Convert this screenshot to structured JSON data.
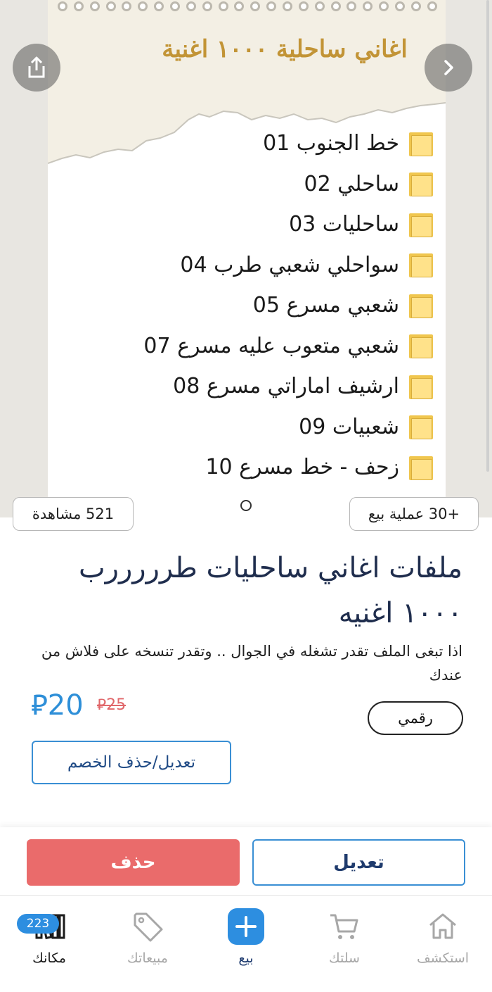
{
  "image": {
    "title": "اغاني ساحلية ١٠٠٠ اغنية",
    "folders": [
      "خط الجنوب 01",
      "ساحلي 02",
      "ساحليات 03",
      "سواحلي شعبي طرب 04",
      "شعبي مسرع 05",
      "شعبي متعوب عليه مسرع 07",
      "ارشيف اماراتي مسرع 08",
      "شعبيات 09",
      "زحف - خط مسرع 10"
    ],
    "share_icon": "share-icon",
    "next_icon": "chevron-right-icon"
  },
  "stats": {
    "views": "521 مشاهدة",
    "sales": "+30 عملية بيع"
  },
  "product": {
    "title": "ملفات اغاني ساحليات طرررررب ١٠٠٠ اغنيه",
    "description": "اذا تبغى الملف تقدر تشغله في الجوال .. وتقدر تنسخه على فلاش من عندك",
    "price_new": "20",
    "price_old": "25",
    "currency_symbol": "⃁",
    "type": "رقمي",
    "discount_button": "تعديل/حذف الخصم"
  },
  "actions": {
    "delete": "حذف",
    "edit": "تعديل"
  },
  "nav": {
    "explore": "استكشف",
    "cart": "سلتك",
    "sell": "بيع",
    "sales": "مبيعاتك",
    "shelf": "مكانك",
    "shelf_badge": "223"
  },
  "colors": {
    "accent": "#2d8ee0",
    "delete": "#ea6b6b",
    "price": "#2e8fd8",
    "old_price": "#e0676a",
    "folder": "#f0c64e",
    "title_gold": "#c29436"
  }
}
